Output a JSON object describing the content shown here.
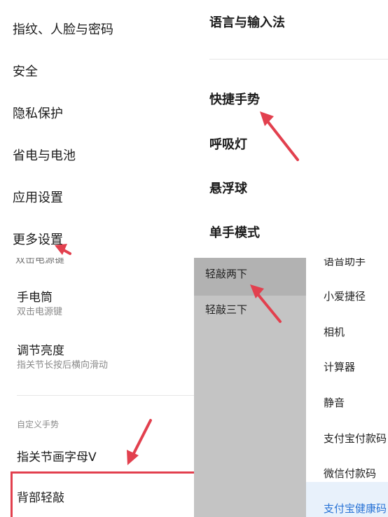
{
  "settings_left": {
    "items": [
      "指纹、人脸与密码",
      "安全",
      "隐私保护",
      "省电与电池",
      "应用设置",
      "更多设置"
    ]
  },
  "settings_right": {
    "items": [
      "语言与输入法",
      "快捷手势",
      "呼吸灯",
      "悬浮球",
      "单手模式"
    ]
  },
  "gestures": {
    "cut_text": "双击电源键",
    "flashlight": {
      "title": "手电筒",
      "sub": "双击电源键"
    },
    "brightness": {
      "title": "调节亮度",
      "sub": "指关节长按后横向滑动"
    },
    "section_label": "自定义手势",
    "knuckle_v": "指关节画字母V",
    "back_tap": "背部轻敲"
  },
  "tap_options": {
    "left": [
      "轻敲两下",
      "轻敲三下"
    ],
    "right": [
      "语音助手",
      "小爱捷径",
      "相机",
      "计算器",
      "静音",
      "支付宝付款码",
      "微信付款码",
      "支付宝健康码"
    ]
  },
  "colors": {
    "arrow": "#e2404e",
    "selected_blue": "#2a74d6"
  }
}
